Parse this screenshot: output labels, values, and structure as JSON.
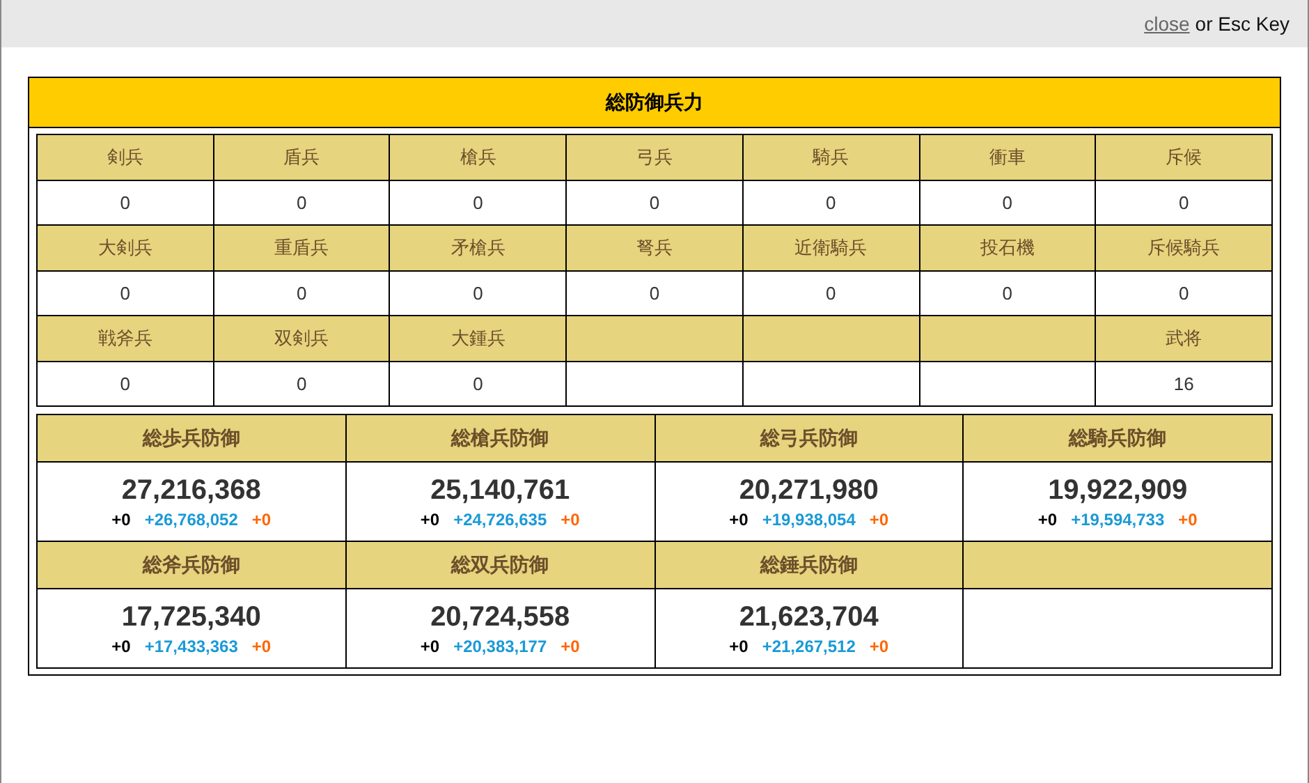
{
  "top_bar": {
    "close_link": "close",
    "hint": "or Esc Key"
  },
  "panel": {
    "title": "総防御兵力"
  },
  "troop_rows": [
    {
      "cells": [
        {
          "kind": "unit",
          "name": "剣兵",
          "count": "0"
        },
        {
          "kind": "unit",
          "name": "盾兵",
          "count": "0"
        },
        {
          "kind": "unit",
          "name": "槍兵",
          "count": "0"
        },
        {
          "kind": "unit",
          "name": "弓兵",
          "count": "0"
        },
        {
          "kind": "unit",
          "name": "騎兵",
          "count": "0"
        },
        {
          "kind": "unit",
          "name": "衝車",
          "count": "0"
        },
        {
          "kind": "unit",
          "name": "斥候",
          "count": "0"
        }
      ]
    },
    {
      "cells": [
        {
          "kind": "unit",
          "name": "大剣兵",
          "count": "0"
        },
        {
          "kind": "unit",
          "name": "重盾兵",
          "count": "0"
        },
        {
          "kind": "unit",
          "name": "矛槍兵",
          "count": "0"
        },
        {
          "kind": "unit",
          "name": "弩兵",
          "count": "0"
        },
        {
          "kind": "unit",
          "name": "近衛騎兵",
          "count": "0"
        },
        {
          "kind": "unit",
          "name": "投石機",
          "count": "0"
        },
        {
          "kind": "unit",
          "name": "斥候騎兵",
          "count": "0"
        }
      ]
    },
    {
      "cells": [
        {
          "kind": "unit",
          "name": "戦斧兵",
          "count": "0"
        },
        {
          "kind": "unit",
          "name": "双剣兵",
          "count": "0"
        },
        {
          "kind": "unit",
          "name": "大鍾兵",
          "count": "0"
        },
        {
          "kind": "empty"
        },
        {
          "kind": "empty"
        },
        {
          "kind": "empty"
        },
        {
          "kind": "unit",
          "name": "武将",
          "count": "16"
        }
      ]
    }
  ],
  "defense_rows": [
    {
      "cells": [
        {
          "kind": "stat",
          "name": "総歩兵防御",
          "total": "27,216,368",
          "bonuses": [
            {
              "text": "+0",
              "color": "#000000"
            },
            {
              "text": "+26,768,052",
              "color": "#1a9ad6"
            },
            {
              "text": "+0",
              "color": "#ff6600"
            }
          ]
        },
        {
          "kind": "stat",
          "name": "総槍兵防御",
          "total": "25,140,761",
          "bonuses": [
            {
              "text": "+0",
              "color": "#000000"
            },
            {
              "text": "+24,726,635",
              "color": "#1a9ad6"
            },
            {
              "text": "+0",
              "color": "#ff6600"
            }
          ]
        },
        {
          "kind": "stat",
          "name": "総弓兵防御",
          "total": "20,271,980",
          "bonuses": [
            {
              "text": "+0",
              "color": "#000000"
            },
            {
              "text": "+19,938,054",
              "color": "#1a9ad6"
            },
            {
              "text": "+0",
              "color": "#ff6600"
            }
          ]
        },
        {
          "kind": "stat",
          "name": "総騎兵防御",
          "total": "19,922,909",
          "bonuses": [
            {
              "text": "+0",
              "color": "#000000"
            },
            {
              "text": "+19,594,733",
              "color": "#1a9ad6"
            },
            {
              "text": "+0",
              "color": "#ff6600"
            }
          ]
        }
      ]
    },
    {
      "cells": [
        {
          "kind": "stat",
          "name": "総斧兵防御",
          "total": "17,725,340",
          "bonuses": [
            {
              "text": "+0",
              "color": "#000000"
            },
            {
              "text": "+17,433,363",
              "color": "#1a9ad6"
            },
            {
              "text": "+0",
              "color": "#ff6600"
            }
          ]
        },
        {
          "kind": "stat",
          "name": "総双兵防御",
          "total": "20,724,558",
          "bonuses": [
            {
              "text": "+0",
              "color": "#000000"
            },
            {
              "text": "+20,383,177",
              "color": "#1a9ad6"
            },
            {
              "text": "+0",
              "color": "#ff6600"
            }
          ]
        },
        {
          "kind": "stat",
          "name": "総錘兵防御",
          "total": "21,623,704",
          "bonuses": [
            {
              "text": "+0",
              "color": "#000000"
            },
            {
              "text": "+21,267,512",
              "color": "#1a9ad6"
            },
            {
              "text": "+0",
              "color": "#ff6600"
            }
          ]
        },
        {
          "kind": "empty"
        }
      ]
    }
  ]
}
